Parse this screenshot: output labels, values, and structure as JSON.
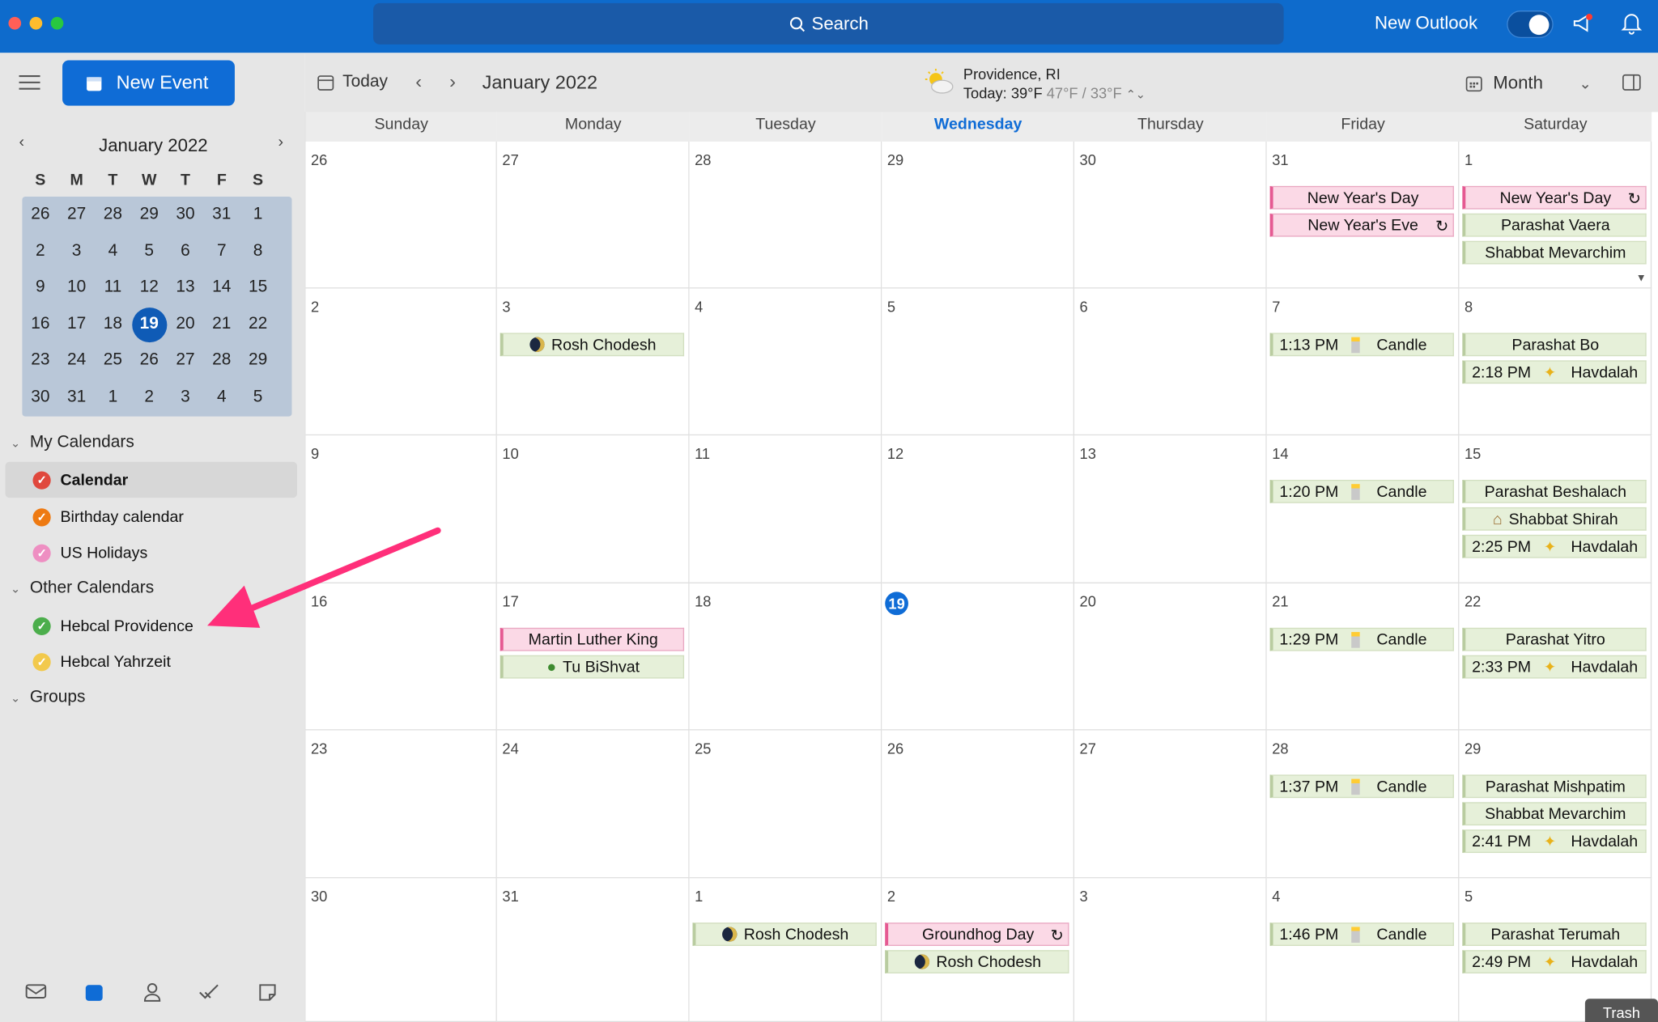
{
  "titlebar": {
    "search_label": "Search",
    "new_outlook_label": "New Outlook",
    "new_outlook_toggle_on": true
  },
  "sidebar": {
    "new_event_label": "New Event",
    "mini_calendar": {
      "month_label": "January 2022",
      "dow": [
        "S",
        "M",
        "T",
        "W",
        "T",
        "F",
        "S"
      ],
      "weeks": [
        [
          "26",
          "27",
          "28",
          "29",
          "30",
          "31",
          "1"
        ],
        [
          "2",
          "3",
          "4",
          "5",
          "6",
          "7",
          "8"
        ],
        [
          "9",
          "10",
          "11",
          "12",
          "13",
          "14",
          "15"
        ],
        [
          "16",
          "17",
          "18",
          "19",
          "20",
          "21",
          "22"
        ],
        [
          "23",
          "24",
          "25",
          "26",
          "27",
          "28",
          "29"
        ],
        [
          "30",
          "31",
          "1",
          "2",
          "3",
          "4",
          "5"
        ]
      ],
      "today": "19"
    },
    "groups": {
      "my_calendars": "My Calendars",
      "other_calendars": "Other Calendars",
      "groups": "Groups"
    },
    "calendars": {
      "calendar": "Calendar",
      "birthday": "Birthday calendar",
      "us_holidays": "US Holidays",
      "hebcal_providence": "Hebcal Providence",
      "hebcal_yahrzeit": "Hebcal Yahrzeit"
    },
    "calendar_colors": {
      "calendar": "#e0483d",
      "birthday": "#ee7a12",
      "us_holidays": "#ee8fc2",
      "hebcal_providence": "#4cae4c",
      "hebcal_yahrzeit": "#f2c94c"
    }
  },
  "toolbar": {
    "today_label": "Today",
    "current_month": "January 2022",
    "weather_location": "Providence, RI",
    "weather_today": "Today: 39°F",
    "weather_range": "47°F / 33°F",
    "view_label": "Month"
  },
  "calendar": {
    "day_headers": [
      "Sunday",
      "Monday",
      "Tuesday",
      "Wednesday",
      "Thursday",
      "Friday",
      "Saturday"
    ],
    "current_day_header": "Wednesday",
    "weeks": [
      [
        "26",
        "27",
        "28",
        "29",
        "30",
        "31",
        "1"
      ],
      [
        "2",
        "3",
        "4",
        "5",
        "6",
        "7",
        "8"
      ],
      [
        "9",
        "10",
        "11",
        "12",
        "13",
        "14",
        "15"
      ],
      [
        "16",
        "17",
        "18",
        "19",
        "20",
        "21",
        "22"
      ],
      [
        "23",
        "24",
        "25",
        "26",
        "27",
        "28",
        "29"
      ],
      [
        "30",
        "31",
        "1",
        "2",
        "3",
        "4",
        "5"
      ]
    ],
    "today_date": "19",
    "events": {
      "w0fri1": "New Year's Day",
      "w0fri2": "New Year's Eve",
      "w0sat1": "New Year's Day",
      "w0sat2": "Parashat Vaera",
      "w0sat3": "Shabbat Mevarchim",
      "w1mon1": "Rosh Chodesh",
      "w1fri_time": "1:13 PM",
      "w1fri": "Candle",
      "w1sat1": "Parashat Bo",
      "w1sat_time": "2:18 PM",
      "w1sat2": "Havdalah",
      "w2fri_time": "1:20 PM",
      "w2fri": "Candle",
      "w2sat1": "Parashat Beshalach",
      "w2sat2": "Shabbat Shirah",
      "w2sat_time": "2:25 PM",
      "w2sat3": "Havdalah",
      "w3mon1": "Martin Luther King",
      "w3mon2": "Tu BiShvat",
      "w3fri_time": "1:29 PM",
      "w3fri": "Candle",
      "w3sat1": "Parashat Yitro",
      "w3sat_time": "2:33 PM",
      "w3sat2": "Havdalah",
      "w4fri_time": "1:37 PM",
      "w4fri": "Candle",
      "w4sat1": "Parashat Mishpatim",
      "w4sat2": "Shabbat Mevarchim",
      "w4sat_time": "2:41 PM",
      "w4sat3": "Havdalah",
      "w5tue1": "Rosh Chodesh",
      "w5wed1": "Groundhog Day",
      "w5wed2": "Rosh Chodesh",
      "w5fri_time": "1:46 PM",
      "w5fri": "Candle",
      "w5sat1": "Parashat Terumah",
      "w5sat_time": "2:49 PM",
      "w5sat2": "Havdalah"
    }
  },
  "dock": {
    "trash_label": "Trash"
  }
}
